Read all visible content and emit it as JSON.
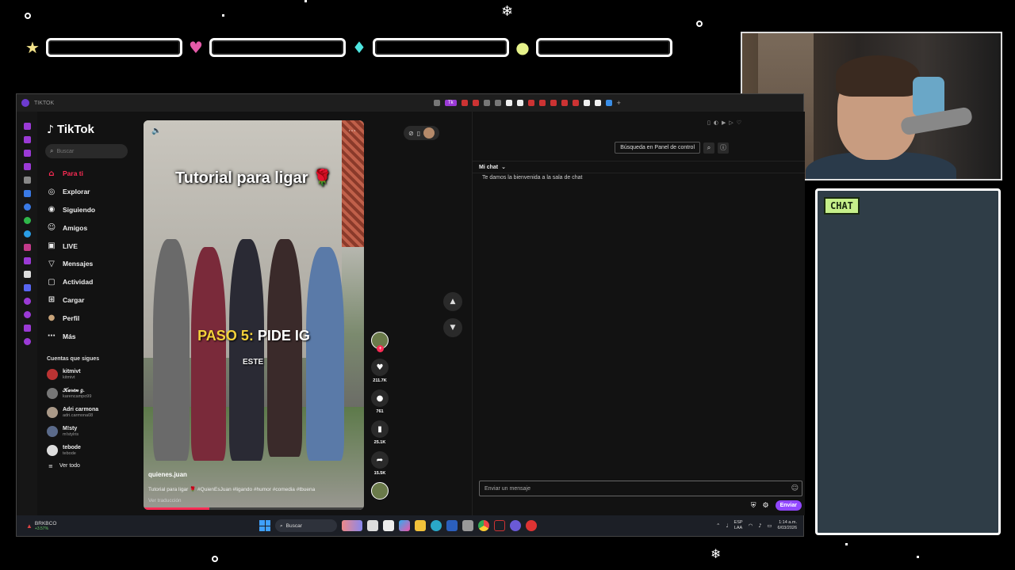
{
  "overlay": {
    "chat_tag": "CHAT",
    "bar_icons": [
      "star-icon",
      "heart-icon",
      "diamond-icon",
      "coin-icon"
    ],
    "bar_colors": [
      "#f3e38a",
      "#e45aa8",
      "#4ee6e0",
      "#e6f28a"
    ]
  },
  "window": {
    "title": "TIKTOK",
    "active_tab": "Tk"
  },
  "tiktok": {
    "logo": "TikTok",
    "search_placeholder": "Buscar",
    "nav": [
      {
        "label": "Para ti",
        "icon": "home-icon"
      },
      {
        "label": "Explorar",
        "icon": "compass-icon"
      },
      {
        "label": "Siguiendo",
        "icon": "following-icon"
      },
      {
        "label": "Amigos",
        "icon": "friends-icon"
      },
      {
        "label": "LIVE",
        "icon": "live-icon"
      },
      {
        "label": "Mensajes",
        "icon": "messages-icon"
      },
      {
        "label": "Actividad",
        "icon": "activity-icon"
      },
      {
        "label": "Cargar",
        "icon": "upload-icon"
      },
      {
        "label": "Perfil",
        "icon": "profile-icon"
      },
      {
        "label": "Más",
        "icon": "more-icon"
      }
    ],
    "following_title": "Cuentas que sigues",
    "accounts": [
      {
        "name": "kitmivt",
        "handle": "kitmivt"
      },
      {
        "name": "𝒦𝒶𝓇𝑒𝓃 𝑔.",
        "handle": "karencampo99"
      },
      {
        "name": "Adri carmona",
        "handle": "adri.carmona08"
      },
      {
        "name": "M!sty",
        "handle": "m!stylris"
      },
      {
        "name": "tebode",
        "handle": "tebode"
      }
    ],
    "see_all": "Ver todo"
  },
  "video": {
    "caption_top": "Tutorial para ligar 🌹",
    "caption_step_yellow": "PASO 5:",
    "caption_step_white": "PIDE IG",
    "caption_small": "ESTE",
    "author": "quienes.juan",
    "description": "Tutorial para ligar 🌹 #QuienEsJuan #ligando #humor #comedia #tbuena",
    "translation": "Ver traducción",
    "progress": 0.3,
    "likes": "211.7K",
    "comments": "761",
    "saves": "25.1K",
    "shares": "15.5K"
  },
  "chat": {
    "search_label": "Búsqueda en Panel de control",
    "room_label": "Mi chat",
    "welcome": "Te damos la bienvenida a la sala de chat",
    "input_placeholder": "Enviar un mensaje",
    "send_label": "Enviar"
  },
  "taskbar": {
    "ticker": "BRKBCO",
    "ticker_change": "+3.57%",
    "search": "Buscar",
    "lang_line1": "ESP",
    "lang_line2": "LAA",
    "time": "1:14 a.m.",
    "date": "6/03/2026"
  }
}
